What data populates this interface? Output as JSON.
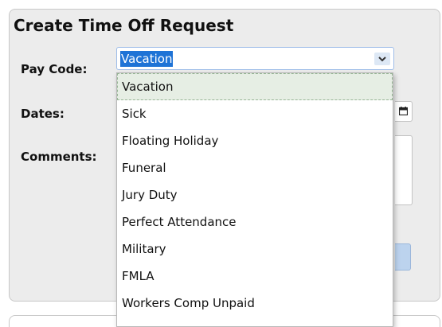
{
  "form": {
    "title": "Create Time Off Request",
    "pay_code_label": "Pay Code:",
    "dates_label": "Dates:",
    "comments_label": "Comments:"
  },
  "pay_code_select": {
    "selected_value": "Vacation",
    "options": [
      "Vacation",
      "Sick",
      "Floating Holiday",
      "Funeral",
      "Jury Duty",
      "Perfect Attendance",
      "Military",
      "FMLA",
      "Workers Comp Unpaid"
    ]
  },
  "icons": {
    "dropdown_arrow": "chevron-down-icon",
    "date_picker": "calendar-icon"
  },
  "colors": {
    "selection_highlight": "#1e73d6",
    "panel_background": "#ececec",
    "hovered_option": "#e6eee4"
  }
}
